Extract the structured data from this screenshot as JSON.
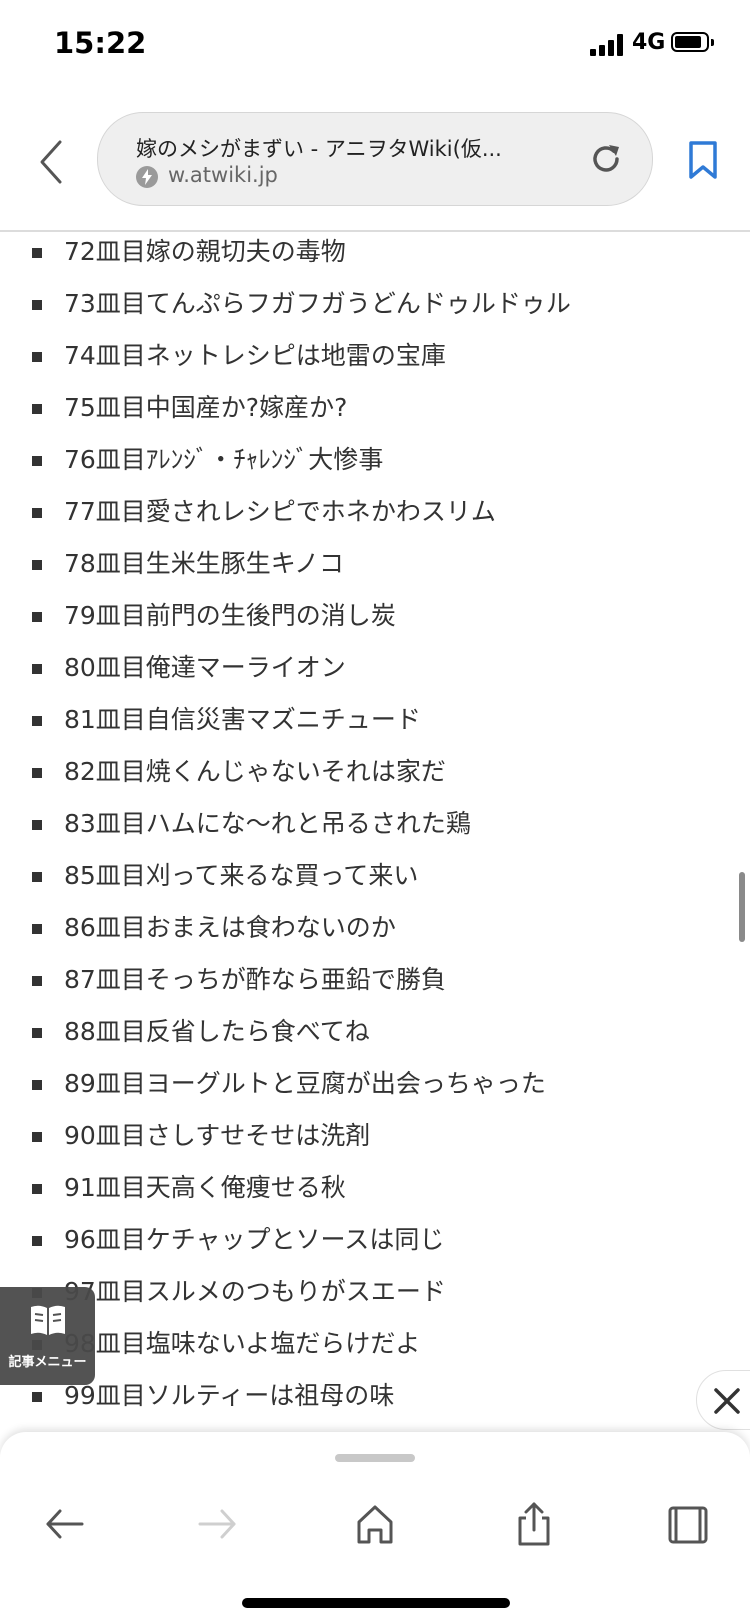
{
  "status_bar": {
    "time": "15:22",
    "network": "4G"
  },
  "browser": {
    "page_title": "嫁のメシがまずい - アニヲタWiki(仮...",
    "host": "w.atwiki.jp"
  },
  "list_items": [
    "72皿目嫁の親切夫の毒物",
    "73皿目てんぷらフガフガうどんドゥルドゥル",
    "74皿目ネットレシピは地雷の宝庫",
    "75皿目中国産か?嫁産か?",
    "76皿目ｱﾚﾝｼﾞ・ﾁｬﾚﾝｼﾞ大惨事",
    "77皿目愛されレシピでホネかわスリム",
    "78皿目生米生豚生キノコ",
    "79皿目前門の生後門の消し炭",
    "80皿目俺達マーライオン",
    "81皿目自信災害マズニチュード",
    "82皿目焼くんじゃないそれは家だ",
    "83皿目ハムにな〜れと吊るされた鶏",
    "85皿目刈って来るな買って来い",
    "86皿目おまえは食わないのか",
    "87皿目そっちが酢なら亜鉛で勝負",
    "88皿目反省したら食べてね",
    "89皿目ヨーグルトと豆腐が出会っちゃった",
    "90皿目さしすせそせは洗剤",
    "91皿目天高く俺痩せる秋",
    "96皿目ケチャップとソースは同じ",
    "97皿目スルメのつもりがスエード",
    "98皿目塩味ないよ塩だらけだよ",
    "99皿目ソルティーは祖母の味"
  ],
  "floating_menu": {
    "label": "記事メニュー",
    "icon": "book-icon"
  },
  "toolbar": {
    "icons": [
      "back-arrow-icon",
      "forward-arrow-icon",
      "home-icon",
      "share-icon",
      "tabs-icon"
    ]
  },
  "colors": {
    "accent": "#2f7ad6",
    "text": "#333333"
  }
}
